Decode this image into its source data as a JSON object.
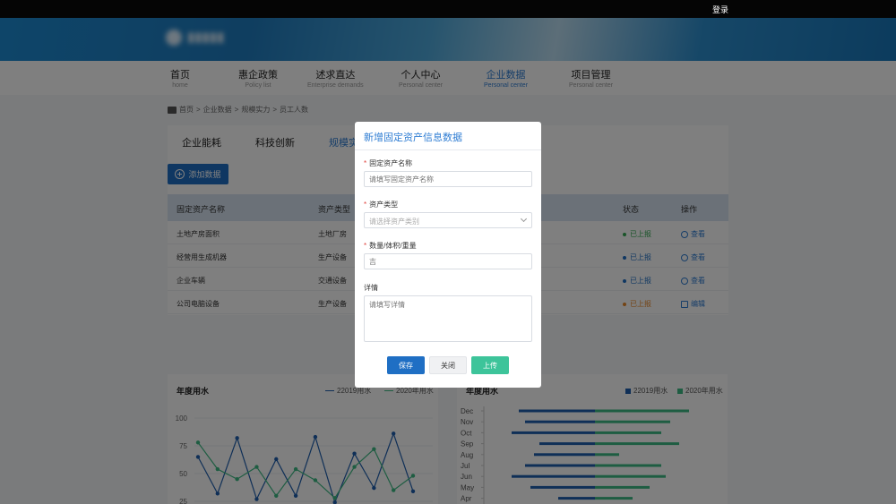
{
  "topbar": {
    "login": "登录"
  },
  "nav": [
    {
      "cn": "首页",
      "en": "home"
    },
    {
      "cn": "惠企政策",
      "en": "Policy list"
    },
    {
      "cn": "述求直达",
      "en": "Enterprise demands"
    },
    {
      "cn": "个人中心",
      "en": "Personal center"
    },
    {
      "cn": "企业数据",
      "en": "Personal center"
    },
    {
      "cn": "项目管理",
      "en": "Personal center"
    }
  ],
  "breadcrumb": [
    "首页",
    ">",
    "企业数据",
    ">",
    "规模实力",
    ">",
    "员工人数"
  ],
  "tabs": [
    "企业能耗",
    "科技创新",
    "规模实"
  ],
  "add_button": "添加数据",
  "table": {
    "headers": [
      "固定资产名称",
      "资产类型",
      "状态",
      "操作"
    ],
    "rows": [
      {
        "name": "土地产房面积",
        "type": "土地厂房",
        "status": "已上报",
        "status_color": "#34a853",
        "op": "查看"
      },
      {
        "name": "经营用生成机器",
        "type": "生产设备",
        "status": "已上报",
        "status_color": "#1f6fc4",
        "op": "查看"
      },
      {
        "name": "企业车辆",
        "type": "交通设备",
        "status": "已上报",
        "status_color": "#1f6fc4",
        "op": "查看"
      },
      {
        "name": "公司电脑设备",
        "type": "生产设备",
        "status": "已上报",
        "status_color": "#e8892b",
        "op": "编辑"
      }
    ]
  },
  "chart_left": {
    "title": "年度用水",
    "legend": [
      "22019用水",
      "2020年用水"
    ],
    "y_ticks": [
      "100",
      "75",
      "50",
      "25"
    ]
  },
  "chart_right": {
    "title": "年度用水",
    "legend": [
      "22019用水",
      "2020年用水"
    ],
    "months": [
      "Dec",
      "Nov",
      "Oct",
      "Sep",
      "Aug",
      "Jul",
      "Jun",
      "May",
      "Apr"
    ]
  },
  "chart_data": [
    {
      "type": "line",
      "title": "年度用水",
      "ylim": [
        25,
        100
      ],
      "series": [
        {
          "name": "22019用水",
          "values": [
            65,
            32,
            82,
            27,
            63,
            30,
            83,
            24,
            68,
            37,
            86,
            34
          ]
        },
        {
          "name": "2020年用水",
          "values": [
            78,
            54,
            45,
            56,
            30,
            54,
            44,
            28,
            56,
            72,
            35,
            48
          ]
        }
      ]
    },
    {
      "type": "bar",
      "title": "年度用水",
      "categories": [
        "Dec",
        "Nov",
        "Oct",
        "Sep",
        "Aug",
        "Jul",
        "Jun",
        "May",
        "Apr"
      ],
      "series": [
        {
          "name": "22019用水",
          "values": [
            -85,
            -78,
            -93,
            -62,
            -68,
            -78,
            -93,
            -72,
            -41
          ]
        },
        {
          "name": "2020年用水",
          "values": [
            105,
            84,
            74,
            94,
            27,
            74,
            79,
            61,
            42
          ]
        }
      ]
    }
  ],
  "colors": {
    "accent": "#2f7dd3",
    "series1": "#1f5fae",
    "series2": "#3dbb84"
  },
  "modal": {
    "title": "新增固定资产信息数据",
    "fields": [
      {
        "label": "固定资产名称",
        "required": true,
        "placeholder": "请填写固定资产名称"
      },
      {
        "label": "资产类型",
        "required": true,
        "placeholder": "请选择资产类别"
      },
      {
        "label": "数量/体积/重量",
        "required": true,
        "placeholder": "吉"
      },
      {
        "label": "详情",
        "required": false,
        "placeholder": "请填写详情"
      }
    ],
    "buttons": {
      "save": "保存",
      "close": "关闭",
      "upload": "上传"
    }
  }
}
